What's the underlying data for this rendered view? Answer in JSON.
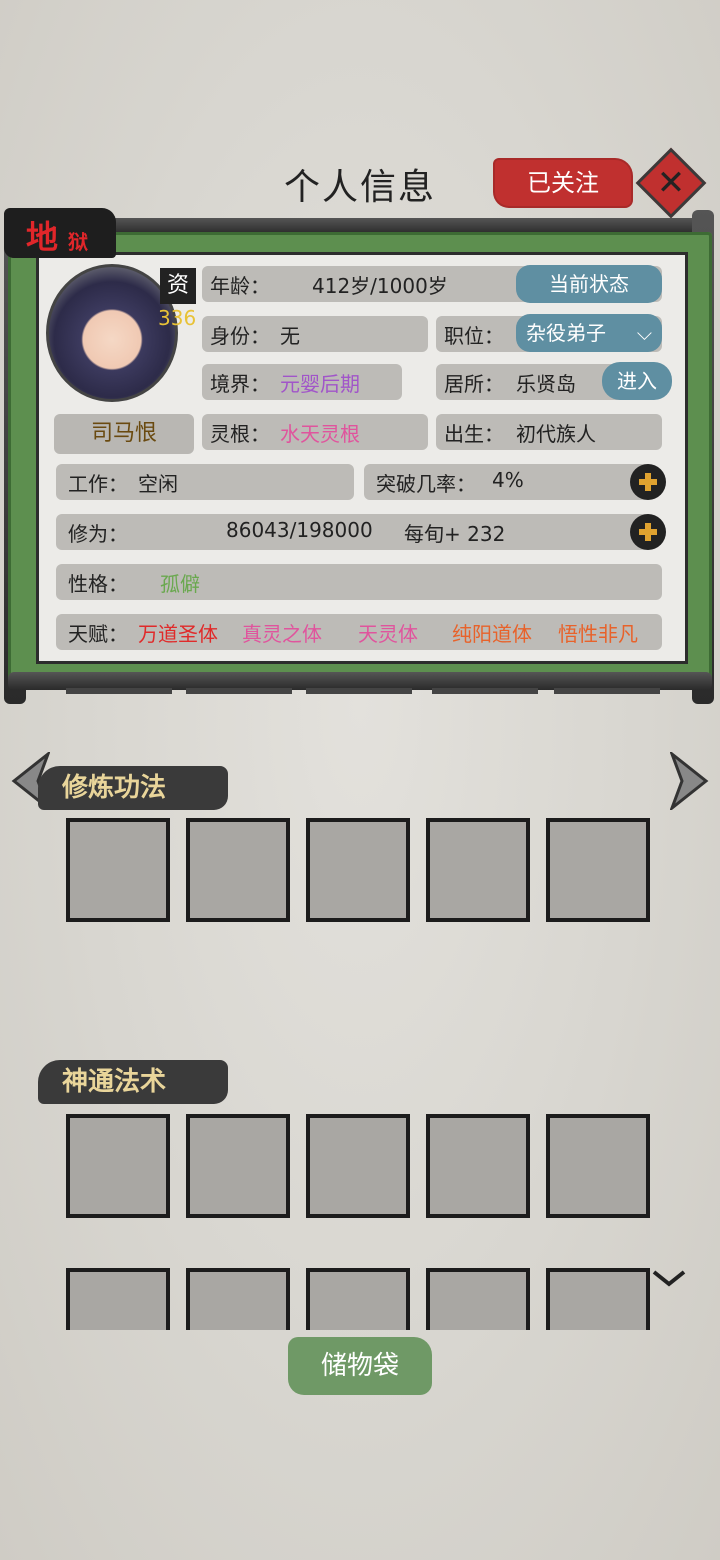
{
  "header": {
    "title": "个人信息",
    "follow_label": "已关注"
  },
  "rank_badge": {
    "char1": "地",
    "char2": "狱"
  },
  "character": {
    "name": "司马恨",
    "aptitude_label": "资",
    "aptitude_value": "336"
  },
  "info": {
    "age_label": "年龄：",
    "age_value": "412岁/1000岁",
    "status_button": "当前状态",
    "identity_label": "身份：",
    "identity_value": "无",
    "position_label": "职位：",
    "position_value": "杂役弟子",
    "realm_label": "境界：",
    "realm_value": "元婴后期",
    "residence_label": "居所：",
    "residence_value": "乐贤岛",
    "enter_button": "进入",
    "root_label": "灵根：",
    "root_value": "水天灵根",
    "birth_label": "出生：",
    "birth_value": "初代族人",
    "work_label": "工作：",
    "work_value": "空闲",
    "breakthrough_label": "突破几率：",
    "breakthrough_value": "4%",
    "cultivation_label": "修为：",
    "cultivation_value": "86043/198000",
    "cultivation_rate": "每旬+ 232",
    "personality_label": "性格：",
    "personality_value": "孤僻",
    "talent_label": "天赋：",
    "talents": [
      "万道圣体",
      "真灵之体",
      "天灵体",
      "纯阳道体",
      "悟性非凡"
    ]
  },
  "colors": {
    "realm": "#a155c9",
    "root": "#e0549d",
    "personality": "#6aa84f",
    "talent_1": "#e02a2a",
    "talent_2": "#e0549d",
    "talent_3": "#e0549d",
    "talent_4": "#e8622a",
    "talent_5": "#e8622a"
  },
  "sections": {
    "techniques": "修炼功法",
    "spells": "神通法术"
  },
  "bag_button": "储物袋"
}
